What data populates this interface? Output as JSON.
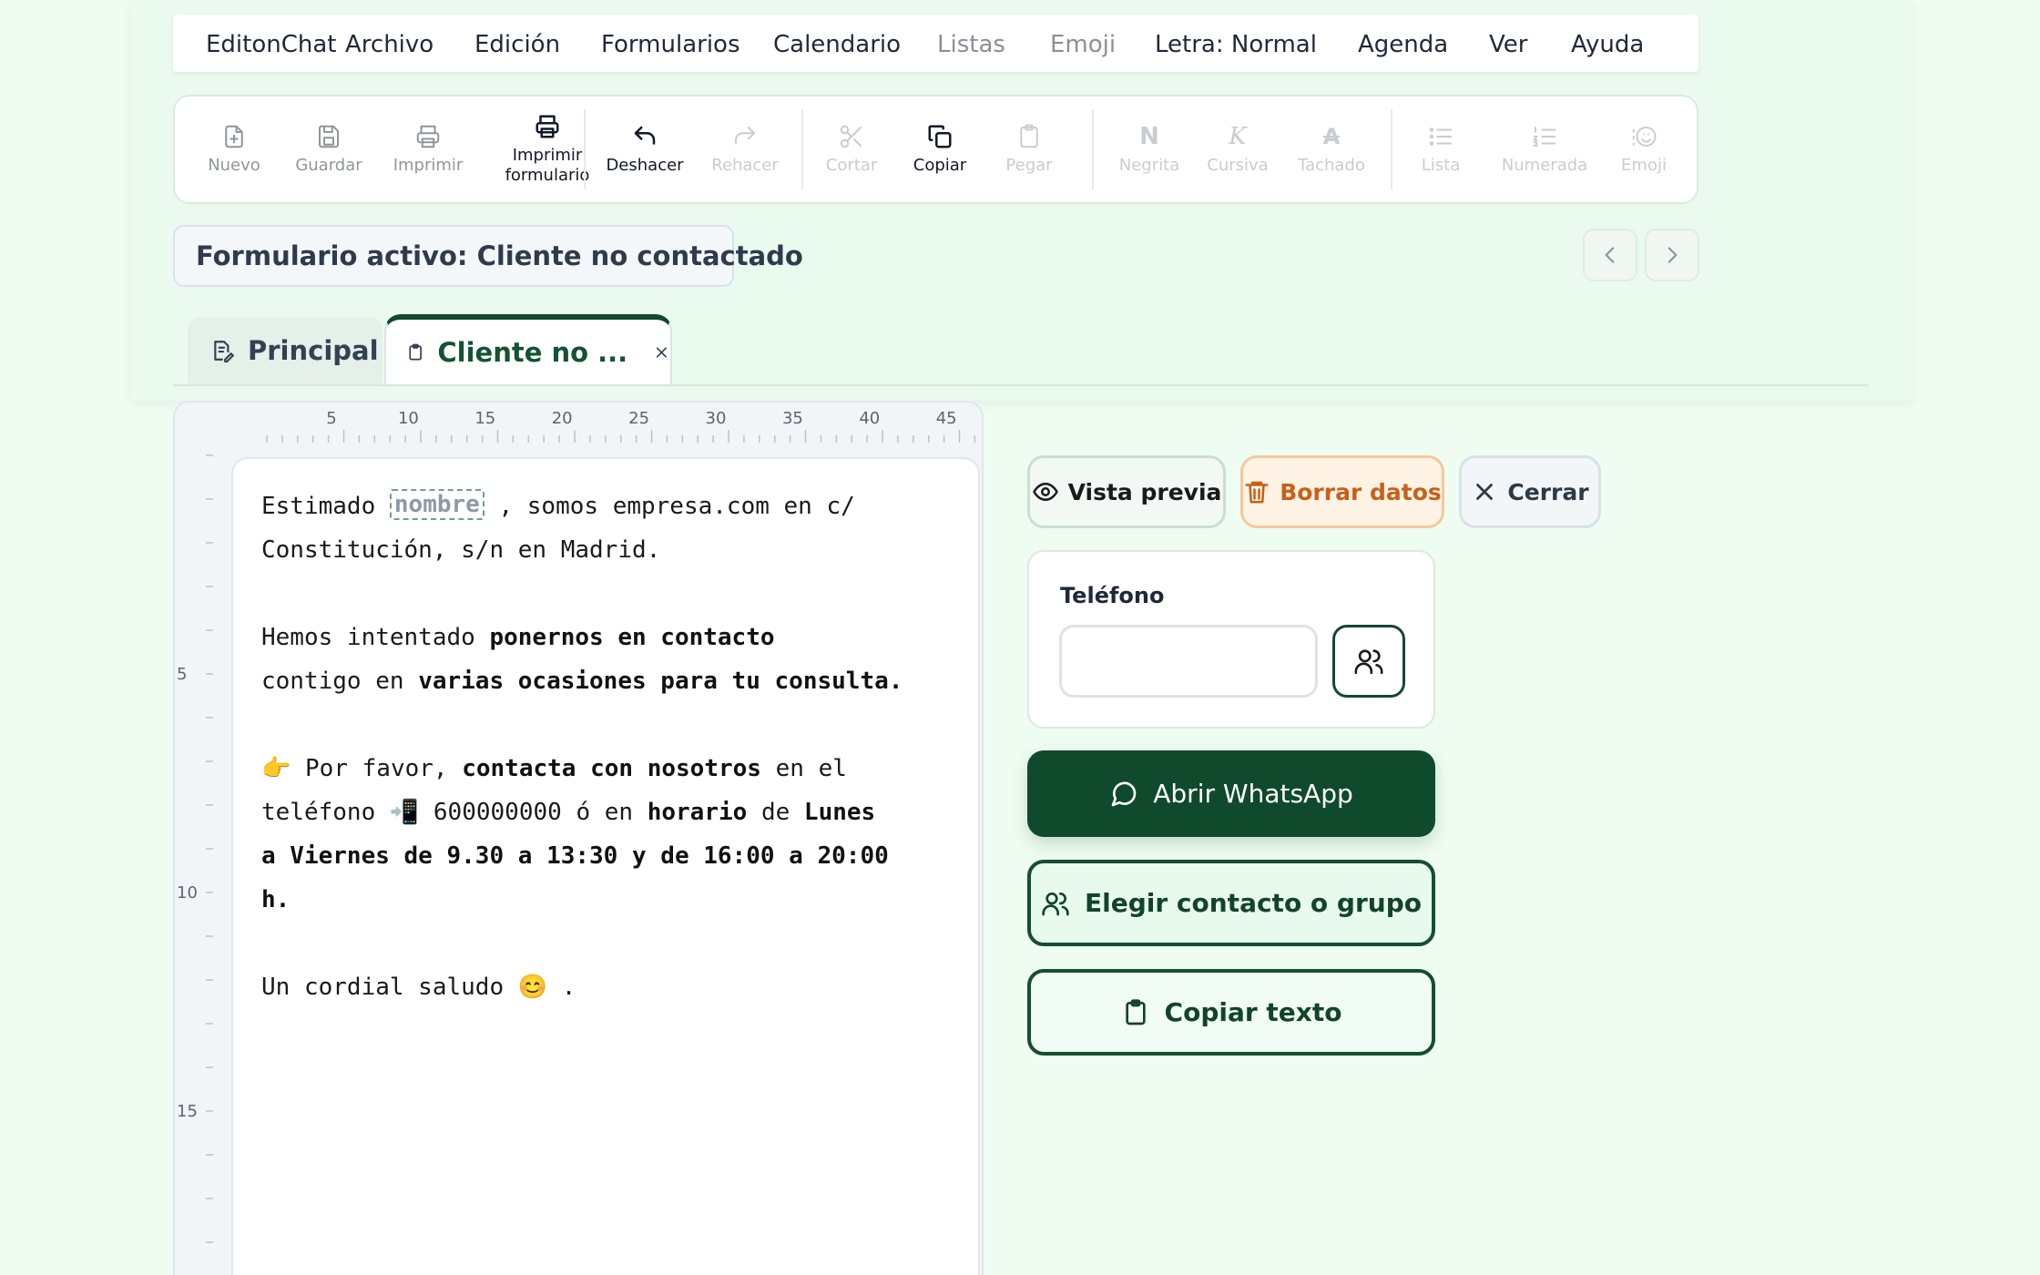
{
  "menu": {
    "app_name": "EditonChat",
    "items": [
      {
        "label": "Archivo"
      },
      {
        "label": "Edición"
      },
      {
        "label": "Formularios"
      },
      {
        "label": "Calendario"
      },
      {
        "label": "Listas"
      },
      {
        "label": "Emoji"
      },
      {
        "label": "Letra: Normal"
      },
      {
        "label": "Agenda"
      },
      {
        "label": "Ver"
      },
      {
        "label": "Ayuda"
      }
    ]
  },
  "toolbar": {
    "nuevo": "Nuevo",
    "guardar": "Guardar",
    "imprimir": "Imprimir",
    "imprimir_formulario": "Imprimir formulario",
    "deshacer": "Deshacer",
    "rehacer": "Rehacer",
    "cortar": "Cortar",
    "copiar": "Copiar",
    "pegar": "Pegar",
    "negrita": "Negrita",
    "cursiva": "Cursiva",
    "tachado": "Tachado",
    "lista": "Lista",
    "numerada": "Numerada",
    "emoji": "Emoji",
    "negrita_glyph": "N",
    "cursiva_glyph": "K",
    "tachado_glyph": "A"
  },
  "active_form": "Formulario activo: Cliente no contactado",
  "tabs": {
    "principal": "Principal",
    "cliente": "Cliente no ..."
  },
  "ruler": {
    "horizontal_ticks": [
      "5",
      "10",
      "15",
      "20",
      "25",
      "30",
      "35",
      "40",
      "45"
    ],
    "vertical_ticks": [
      "5",
      "10",
      "15"
    ]
  },
  "document": {
    "greeting_before": "Estimado ",
    "placeholder": "nombre",
    "greeting_after": " , somos empresa.com en c/",
    "line2": "Constitución, s/n en Madrid.",
    "p2_a": "Hemos intentado ",
    "p2_b": "ponernos en contacto",
    "p2_c": "contigo en ",
    "p2_d": "varias ocasiones para tu consulta.",
    "p3_a": "👉 Por favor, ",
    "p3_b": "contacta con nosotros",
    "p3_c": " en el",
    "p3_d": "teléfono 📲 600000000 ó en ",
    "p3_e": "horario",
    "p3_f": " de ",
    "p3_g": "Lunes",
    "p3_h": "a Viernes de 9.30 a 13:30 y de 16:00 a 20:00",
    "p3_i": "h.",
    "closing": "Un cordial saludo 😊 ."
  },
  "actions": {
    "vista_previa": "Vista previa",
    "borrar_datos": "Borrar datos",
    "cerrar": "Cerrar",
    "telefono_label": "Teléfono",
    "telefono_value": "",
    "telefono_placeholder": "",
    "abrir_whatsapp": "Abrir WhatsApp",
    "elegir_contacto": "Elegir contacto o grupo",
    "copiar_texto": "Copiar texto"
  },
  "colors": {
    "background": "#effcf2",
    "primary_green": "#0f4a2c",
    "danger_orange": "#c86018",
    "tab_accent": "#0f4a2c"
  }
}
